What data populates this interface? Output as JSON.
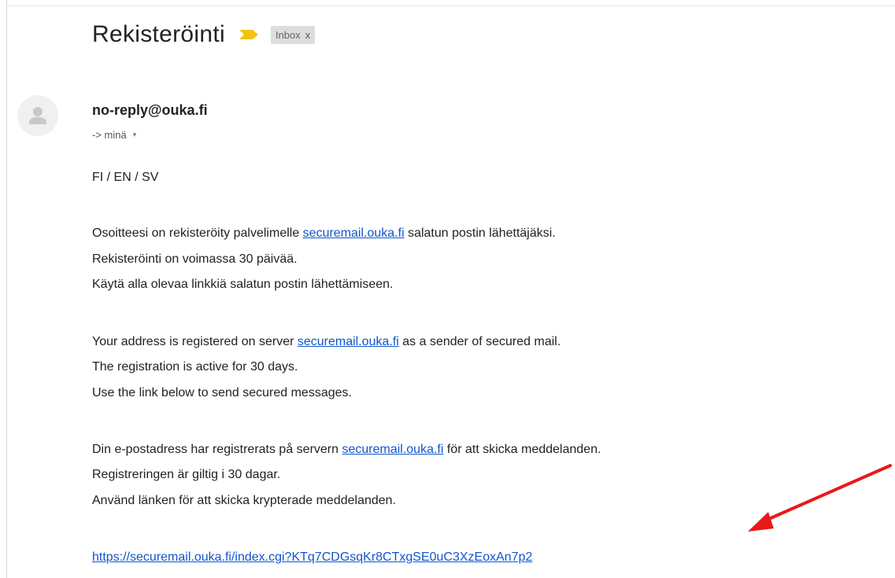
{
  "email": {
    "subject": "Rekisteröinti",
    "label": "Inbox",
    "label_close": "x",
    "sender": "no-reply@ouka.fi",
    "recipient_prefix": "-> minä",
    "recipient_caret": "▾"
  },
  "body": {
    "languages": "FI / EN / SV",
    "fi": {
      "line1_pre": "Osoitteesi on rekisteröity palvelimelle ",
      "line1_link": "securemail.ouka.fi",
      "line1_post": " salatun postin lähettäjäksi.",
      "line2": "Rekisteröinti on voimassa 30 päivää.",
      "line3": "Käytä alla olevaa linkkiä salatun postin lähettämiseen."
    },
    "en": {
      "line1_pre": "Your address is registered on server ",
      "line1_link": "securemail.ouka.fi",
      "line1_post": " as a sender of secured mail.",
      "line2": "The registration is active for 30 days.",
      "line3": "Use the link below to send secured messages."
    },
    "sv": {
      "line1_pre": "Din e-postadress har registrerats på servern ",
      "line1_link": "securemail.ouka.fi",
      "line1_post": " för att skicka meddelanden.",
      "line2": "Registreringen är giltig i 30 dagar.",
      "line3": "Använd länken för att skicka krypterade meddelanden."
    },
    "main_link": "https://securemail.ouka.fi/index.cgi?KTq7CDGsqKr8CTxgSE0uC3XzEoxAn7p2"
  },
  "colors": {
    "link": "#1155cc",
    "arrow": "#e8191a",
    "importance": "#f4c20d"
  }
}
